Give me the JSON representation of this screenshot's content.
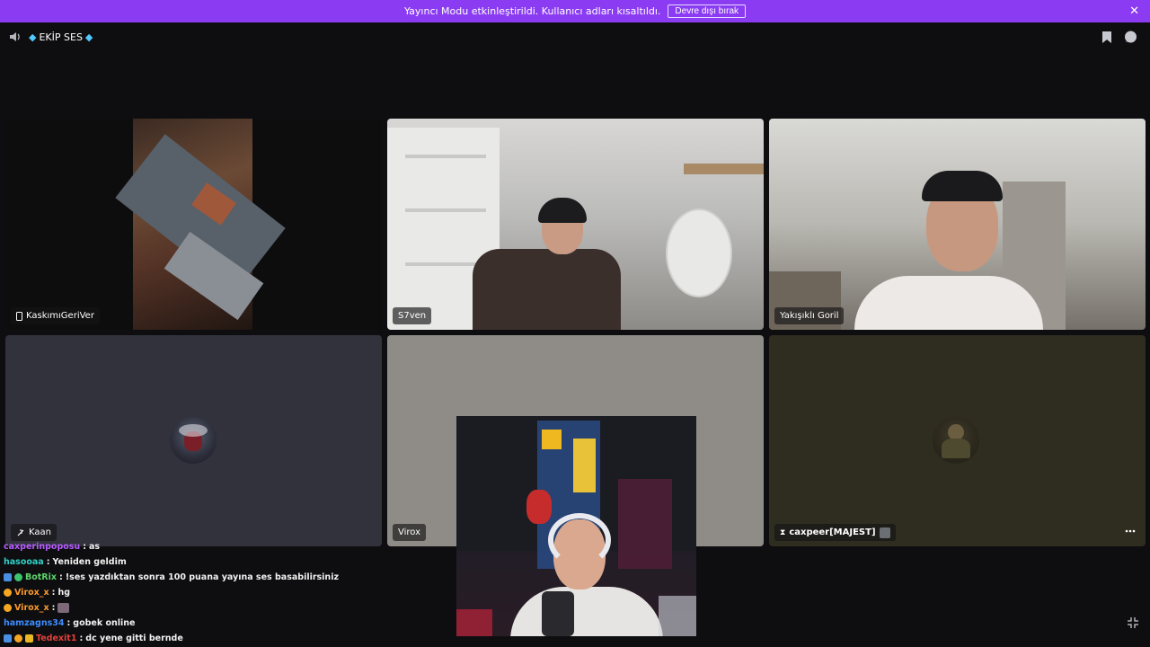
{
  "banner": {
    "text": "Yayıncı Modu etkinleştirildi. Kullanıcı adları kısaltıldı.",
    "button": "Devre dışı bırak"
  },
  "channel": {
    "name": "EKİP SES"
  },
  "participants": [
    {
      "name": "KaskımıGeriVer"
    },
    {
      "name": "S7ven"
    },
    {
      "name": "Yakışıklı Goril"
    },
    {
      "name": "Kaan"
    },
    {
      "name": "Virox"
    },
    {
      "name": "caxpeer[MAJEST]"
    }
  ],
  "chat": [
    {
      "user": "caxperinpoposu",
      "color": "#b65cff",
      "message": "as"
    },
    {
      "user": "hasooaa",
      "color": "#2fd0c8",
      "message": "Yeniden geldim"
    },
    {
      "user": "BotRix",
      "color": "#5dd66c",
      "message": "!ses yazdıktan sonra 100 puana yayına ses basabilirsiniz"
    },
    {
      "user": "Virox_x",
      "color": "#ff9a2a",
      "message": "hg"
    },
    {
      "user": "Virox_x",
      "color": "#ff9a2a",
      "message": ""
    },
    {
      "user": "hamzagns34",
      "color": "#3d8cff",
      "message": "gobek online"
    },
    {
      "user": "Tedexit1",
      "color": "#e0413a",
      "message": "dc yene gitti bernde"
    }
  ],
  "colors": {
    "banner": "#8b3cf2",
    "background": "#0e0e10",
    "tile_dark": "#31323c",
    "tile_grey": "#8f8c87",
    "tile_olive": "#2f2c20"
  }
}
